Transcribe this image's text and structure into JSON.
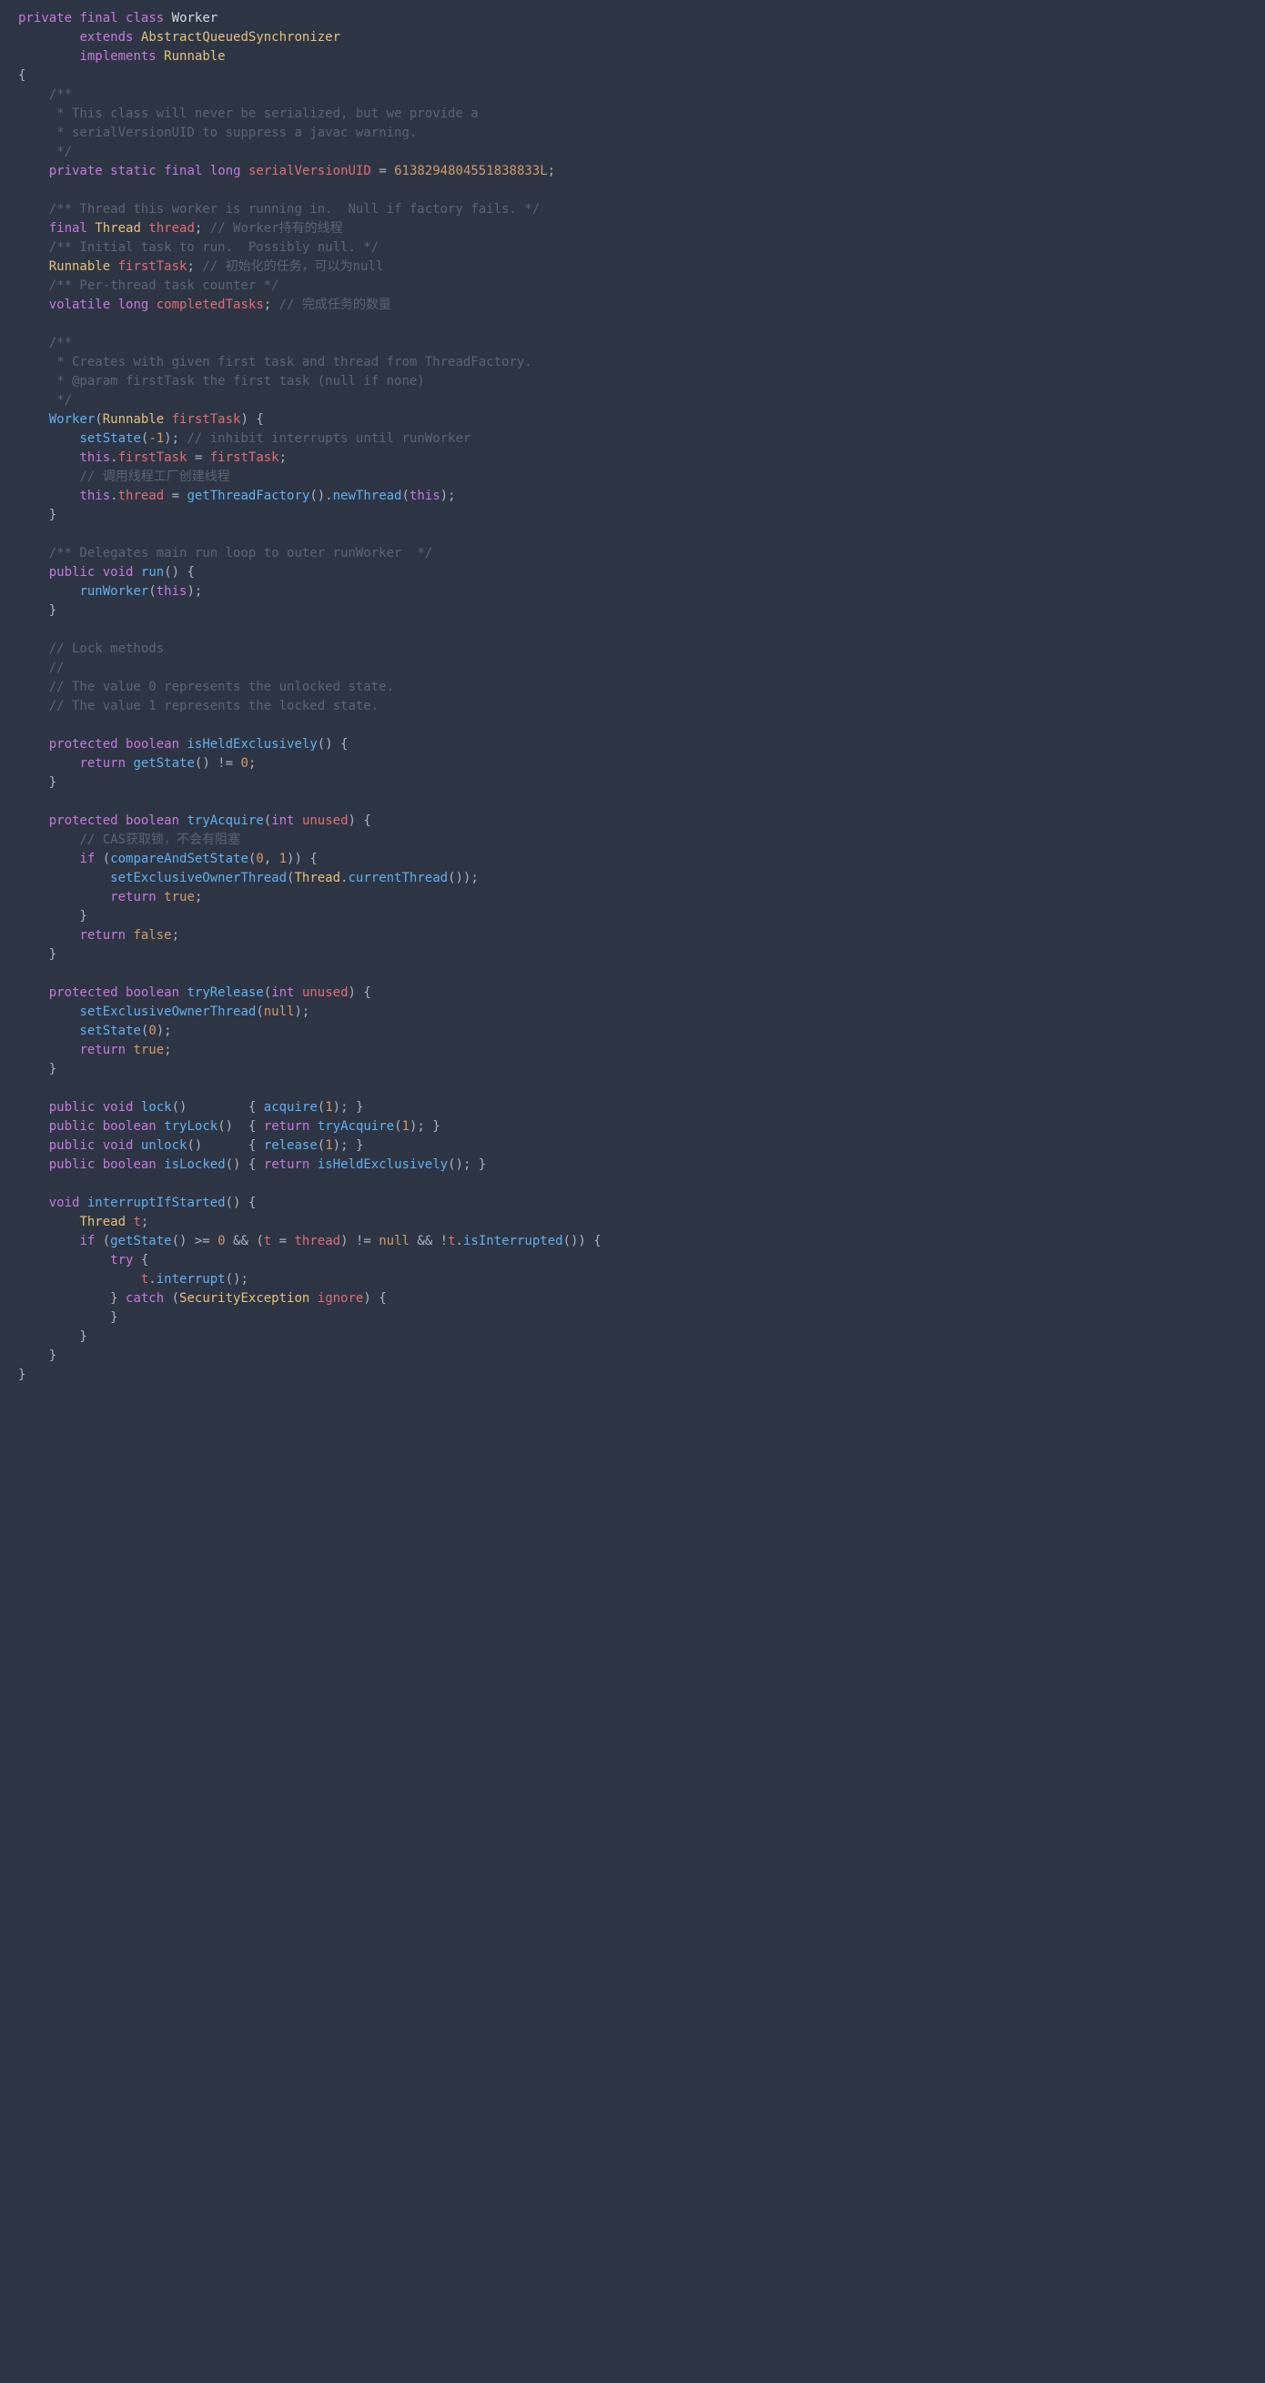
{
  "code": {
    "lines": [
      [
        [
          "kw",
          "private"
        ],
        [
          "op",
          " "
        ],
        [
          "kw",
          "final"
        ],
        [
          "op",
          " "
        ],
        [
          "kw",
          "class"
        ],
        [
          "op",
          " "
        ],
        [
          "white",
          "Worker"
        ]
      ],
      [
        [
          "op",
          "        "
        ],
        [
          "kw",
          "extends"
        ],
        [
          "op",
          " "
        ],
        [
          "type",
          "AbstractQueuedSynchronizer"
        ]
      ],
      [
        [
          "op",
          "        "
        ],
        [
          "kw",
          "implements"
        ],
        [
          "op",
          " "
        ],
        [
          "type",
          "Runnable"
        ]
      ],
      [
        [
          "op",
          "{"
        ]
      ],
      [
        [
          "op",
          "    "
        ],
        [
          "cmt",
          "/**"
        ]
      ],
      [
        [
          "op",
          "    "
        ],
        [
          "cmt",
          " * This class will never be serialized, but we provide a"
        ]
      ],
      [
        [
          "op",
          "    "
        ],
        [
          "cmt",
          " * serialVersionUID to suppress a javac warning."
        ]
      ],
      [
        [
          "op",
          "    "
        ],
        [
          "cmt",
          " */"
        ]
      ],
      [
        [
          "op",
          "    "
        ],
        [
          "kw",
          "private"
        ],
        [
          "op",
          " "
        ],
        [
          "kw",
          "static"
        ],
        [
          "op",
          " "
        ],
        [
          "kw",
          "final"
        ],
        [
          "op",
          " "
        ],
        [
          "kw",
          "long"
        ],
        [
          "op",
          " "
        ],
        [
          "var",
          "serialVersionUID"
        ],
        [
          "op",
          " = "
        ],
        [
          "num",
          "6138294804551838833L"
        ],
        [
          "op",
          ";"
        ]
      ],
      [
        [
          "op",
          ""
        ]
      ],
      [
        [
          "op",
          "    "
        ],
        [
          "cmt",
          "/** Thread this worker is running in.  Null if factory fails. */"
        ]
      ],
      [
        [
          "op",
          "    "
        ],
        [
          "kw",
          "final"
        ],
        [
          "op",
          " "
        ],
        [
          "type",
          "Thread"
        ],
        [
          "op",
          " "
        ],
        [
          "var",
          "thread"
        ],
        [
          "op",
          "; "
        ],
        [
          "cmt",
          "// Worker持有的线程"
        ]
      ],
      [
        [
          "op",
          "    "
        ],
        [
          "cmt",
          "/** Initial task to run.  Possibly null. */"
        ]
      ],
      [
        [
          "op",
          "    "
        ],
        [
          "type",
          "Runnable"
        ],
        [
          "op",
          " "
        ],
        [
          "var",
          "firstTask"
        ],
        [
          "op",
          "; "
        ],
        [
          "cmt",
          "// 初始化的任务，可以为null"
        ]
      ],
      [
        [
          "op",
          "    "
        ],
        [
          "cmt",
          "/** Per-thread task counter */"
        ]
      ],
      [
        [
          "op",
          "    "
        ],
        [
          "kw",
          "volatile"
        ],
        [
          "op",
          " "
        ],
        [
          "kw",
          "long"
        ],
        [
          "op",
          " "
        ],
        [
          "var",
          "completedTasks"
        ],
        [
          "op",
          "; "
        ],
        [
          "cmt",
          "// 完成任务的数量"
        ]
      ],
      [
        [
          "op",
          ""
        ]
      ],
      [
        [
          "op",
          "    "
        ],
        [
          "cmt",
          "/**"
        ]
      ],
      [
        [
          "op",
          "    "
        ],
        [
          "cmt",
          " * Creates with given first task and thread from ThreadFactory."
        ]
      ],
      [
        [
          "op",
          "    "
        ],
        [
          "cmt",
          " * @param firstTask the first task (null if none)"
        ]
      ],
      [
        [
          "op",
          "    "
        ],
        [
          "cmt",
          " */"
        ]
      ],
      [
        [
          "op",
          "    "
        ],
        [
          "fn",
          "Worker"
        ],
        [
          "op",
          "("
        ],
        [
          "type",
          "Runnable"
        ],
        [
          "op",
          " "
        ],
        [
          "var",
          "firstTask"
        ],
        [
          "op",
          ") {"
        ]
      ],
      [
        [
          "op",
          "        "
        ],
        [
          "fn",
          "setState"
        ],
        [
          "op",
          "("
        ],
        [
          "num",
          "-1"
        ],
        [
          "op",
          "); "
        ],
        [
          "cmt",
          "// inhibit interrupts until runWorker"
        ]
      ],
      [
        [
          "op",
          "        "
        ],
        [
          "kw",
          "this"
        ],
        [
          "op",
          "."
        ],
        [
          "prop",
          "firstTask"
        ],
        [
          "op",
          " = "
        ],
        [
          "var",
          "firstTask"
        ],
        [
          "op",
          ";"
        ]
      ],
      [
        [
          "op",
          "        "
        ],
        [
          "cmt",
          "// 调用线程工厂创建线程"
        ]
      ],
      [
        [
          "op",
          "        "
        ],
        [
          "kw",
          "this"
        ],
        [
          "op",
          "."
        ],
        [
          "prop",
          "thread"
        ],
        [
          "op",
          " = "
        ],
        [
          "fn",
          "getThreadFactory"
        ],
        [
          "op",
          "()."
        ],
        [
          "fn",
          "newThread"
        ],
        [
          "op",
          "("
        ],
        [
          "kw",
          "this"
        ],
        [
          "op",
          ");"
        ]
      ],
      [
        [
          "op",
          "    }"
        ]
      ],
      [
        [
          "op",
          ""
        ]
      ],
      [
        [
          "op",
          "    "
        ],
        [
          "cmt",
          "/** Delegates main run loop to outer runWorker  */"
        ]
      ],
      [
        [
          "op",
          "    "
        ],
        [
          "kw",
          "public"
        ],
        [
          "op",
          " "
        ],
        [
          "kw",
          "void"
        ],
        [
          "op",
          " "
        ],
        [
          "fn",
          "run"
        ],
        [
          "op",
          "() {"
        ]
      ],
      [
        [
          "op",
          "        "
        ],
        [
          "fn",
          "runWorker"
        ],
        [
          "op",
          "("
        ],
        [
          "kw",
          "this"
        ],
        [
          "op",
          ");"
        ]
      ],
      [
        [
          "op",
          "    }"
        ]
      ],
      [
        [
          "op",
          ""
        ]
      ],
      [
        [
          "op",
          "    "
        ],
        [
          "cmt",
          "// Lock methods"
        ]
      ],
      [
        [
          "op",
          "    "
        ],
        [
          "cmt",
          "//"
        ]
      ],
      [
        [
          "op",
          "    "
        ],
        [
          "cmt",
          "// The value 0 represents the unlocked state."
        ]
      ],
      [
        [
          "op",
          "    "
        ],
        [
          "cmt",
          "// The value 1 represents the locked state."
        ]
      ],
      [
        [
          "op",
          ""
        ]
      ],
      [
        [
          "op",
          "    "
        ],
        [
          "kw",
          "protected"
        ],
        [
          "op",
          " "
        ],
        [
          "kw",
          "boolean"
        ],
        [
          "op",
          " "
        ],
        [
          "fn",
          "isHeldExclusively"
        ],
        [
          "op",
          "() {"
        ]
      ],
      [
        [
          "op",
          "        "
        ],
        [
          "kw",
          "return"
        ],
        [
          "op",
          " "
        ],
        [
          "fn",
          "getState"
        ],
        [
          "op",
          "() != "
        ],
        [
          "num",
          "0"
        ],
        [
          "op",
          ";"
        ]
      ],
      [
        [
          "op",
          "    }"
        ]
      ],
      [
        [
          "op",
          ""
        ]
      ],
      [
        [
          "op",
          "    "
        ],
        [
          "kw",
          "protected"
        ],
        [
          "op",
          " "
        ],
        [
          "kw",
          "boolean"
        ],
        [
          "op",
          " "
        ],
        [
          "fn",
          "tryAcquire"
        ],
        [
          "op",
          "("
        ],
        [
          "kw",
          "int"
        ],
        [
          "op",
          " "
        ],
        [
          "var",
          "unused"
        ],
        [
          "op",
          ") {"
        ]
      ],
      [
        [
          "op",
          "        "
        ],
        [
          "cmt",
          "// CAS获取锁，不会有阻塞"
        ]
      ],
      [
        [
          "op",
          "        "
        ],
        [
          "kw",
          "if"
        ],
        [
          "op",
          " ("
        ],
        [
          "fn",
          "compareAndSetState"
        ],
        [
          "op",
          "("
        ],
        [
          "num",
          "0"
        ],
        [
          "op",
          ", "
        ],
        [
          "num",
          "1"
        ],
        [
          "op",
          ")) {"
        ]
      ],
      [
        [
          "op",
          "            "
        ],
        [
          "fn",
          "setExclusiveOwnerThread"
        ],
        [
          "op",
          "("
        ],
        [
          "type",
          "Thread"
        ],
        [
          "op",
          "."
        ],
        [
          "fn",
          "currentThread"
        ],
        [
          "op",
          "());"
        ]
      ],
      [
        [
          "op",
          "            "
        ],
        [
          "kw",
          "return"
        ],
        [
          "op",
          " "
        ],
        [
          "bool",
          "true"
        ],
        [
          "op",
          ";"
        ]
      ],
      [
        [
          "op",
          "        }"
        ]
      ],
      [
        [
          "op",
          "        "
        ],
        [
          "kw",
          "return"
        ],
        [
          "op",
          " "
        ],
        [
          "bool",
          "false"
        ],
        [
          "op",
          ";"
        ]
      ],
      [
        [
          "op",
          "    }"
        ]
      ],
      [
        [
          "op",
          ""
        ]
      ],
      [
        [
          "op",
          "    "
        ],
        [
          "kw",
          "protected"
        ],
        [
          "op",
          " "
        ],
        [
          "kw",
          "boolean"
        ],
        [
          "op",
          " "
        ],
        [
          "fn",
          "tryRelease"
        ],
        [
          "op",
          "("
        ],
        [
          "kw",
          "int"
        ],
        [
          "op",
          " "
        ],
        [
          "var",
          "unused"
        ],
        [
          "op",
          ") {"
        ]
      ],
      [
        [
          "op",
          "        "
        ],
        [
          "fn",
          "setExclusiveOwnerThread"
        ],
        [
          "op",
          "("
        ],
        [
          "bool",
          "null"
        ],
        [
          "op",
          ");"
        ]
      ],
      [
        [
          "op",
          "        "
        ],
        [
          "fn",
          "setState"
        ],
        [
          "op",
          "("
        ],
        [
          "num",
          "0"
        ],
        [
          "op",
          ");"
        ]
      ],
      [
        [
          "op",
          "        "
        ],
        [
          "kw",
          "return"
        ],
        [
          "op",
          " "
        ],
        [
          "bool",
          "true"
        ],
        [
          "op",
          ";"
        ]
      ],
      [
        [
          "op",
          "    }"
        ]
      ],
      [
        [
          "op",
          ""
        ]
      ],
      [
        [
          "op",
          "    "
        ],
        [
          "kw",
          "public"
        ],
        [
          "op",
          " "
        ],
        [
          "kw",
          "void"
        ],
        [
          "op",
          " "
        ],
        [
          "fn",
          "lock"
        ],
        [
          "op",
          "()        { "
        ],
        [
          "fn",
          "acquire"
        ],
        [
          "op",
          "("
        ],
        [
          "num",
          "1"
        ],
        [
          "op",
          "); }"
        ]
      ],
      [
        [
          "op",
          "    "
        ],
        [
          "kw",
          "public"
        ],
        [
          "op",
          " "
        ],
        [
          "kw",
          "boolean"
        ],
        [
          "op",
          " "
        ],
        [
          "fn",
          "tryLock"
        ],
        [
          "op",
          "()  { "
        ],
        [
          "kw",
          "return"
        ],
        [
          "op",
          " "
        ],
        [
          "fn",
          "tryAcquire"
        ],
        [
          "op",
          "("
        ],
        [
          "num",
          "1"
        ],
        [
          "op",
          "); }"
        ]
      ],
      [
        [
          "op",
          "    "
        ],
        [
          "kw",
          "public"
        ],
        [
          "op",
          " "
        ],
        [
          "kw",
          "void"
        ],
        [
          "op",
          " "
        ],
        [
          "fn",
          "unlock"
        ],
        [
          "op",
          "()      { "
        ],
        [
          "fn",
          "release"
        ],
        [
          "op",
          "("
        ],
        [
          "num",
          "1"
        ],
        [
          "op",
          "); }"
        ]
      ],
      [
        [
          "op",
          "    "
        ],
        [
          "kw",
          "public"
        ],
        [
          "op",
          " "
        ],
        [
          "kw",
          "boolean"
        ],
        [
          "op",
          " "
        ],
        [
          "fn",
          "isLocked"
        ],
        [
          "op",
          "() { "
        ],
        [
          "kw",
          "return"
        ],
        [
          "op",
          " "
        ],
        [
          "fn",
          "isHeldExclusively"
        ],
        [
          "op",
          "(); }"
        ]
      ],
      [
        [
          "op",
          ""
        ]
      ],
      [
        [
          "op",
          "    "
        ],
        [
          "kw",
          "void"
        ],
        [
          "op",
          " "
        ],
        [
          "fn",
          "interruptIfStarted"
        ],
        [
          "op",
          "() {"
        ]
      ],
      [
        [
          "op",
          "        "
        ],
        [
          "type",
          "Thread"
        ],
        [
          "op",
          " "
        ],
        [
          "var",
          "t"
        ],
        [
          "op",
          ";"
        ]
      ],
      [
        [
          "op",
          "        "
        ],
        [
          "kw",
          "if"
        ],
        [
          "op",
          " ("
        ],
        [
          "fn",
          "getState"
        ],
        [
          "op",
          "() >= "
        ],
        [
          "num",
          "0"
        ],
        [
          "op",
          " && ("
        ],
        [
          "var",
          "t"
        ],
        [
          "op",
          " = "
        ],
        [
          "var",
          "thread"
        ],
        [
          "op",
          ") != "
        ],
        [
          "bool",
          "null"
        ],
        [
          "op",
          " && !"
        ],
        [
          "var",
          "t"
        ],
        [
          "op",
          "."
        ],
        [
          "fn",
          "isInterrupted"
        ],
        [
          "op",
          "()) {"
        ]
      ],
      [
        [
          "op",
          "            "
        ],
        [
          "kw",
          "try"
        ],
        [
          "op",
          " {"
        ]
      ],
      [
        [
          "op",
          "                "
        ],
        [
          "var",
          "t"
        ],
        [
          "op",
          "."
        ],
        [
          "fn",
          "interrupt"
        ],
        [
          "op",
          "();"
        ]
      ],
      [
        [
          "op",
          "            } "
        ],
        [
          "kw",
          "catch"
        ],
        [
          "op",
          " ("
        ],
        [
          "type",
          "SecurityException"
        ],
        [
          "op",
          " "
        ],
        [
          "var",
          "ignore"
        ],
        [
          "op",
          ") {"
        ]
      ],
      [
        [
          "op",
          "            }"
        ]
      ],
      [
        [
          "op",
          "        }"
        ]
      ],
      [
        [
          "op",
          "    }"
        ]
      ],
      [
        [
          "op",
          "}"
        ]
      ]
    ]
  }
}
